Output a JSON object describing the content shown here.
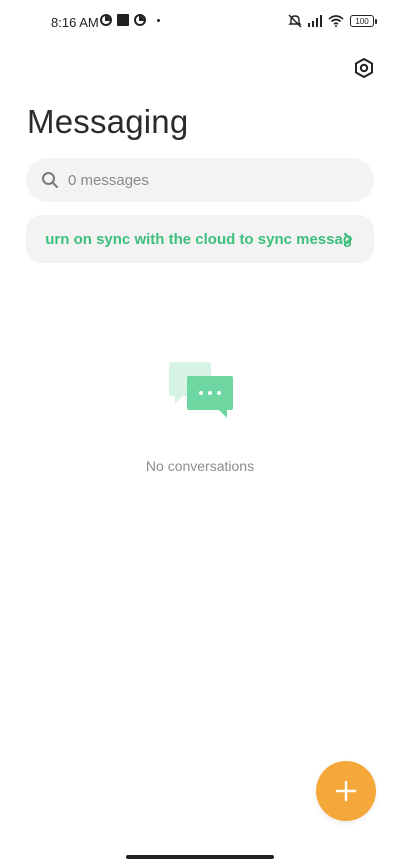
{
  "status_bar": {
    "time": "8:16 AM",
    "battery": "100",
    "icons": [
      "notification-icon",
      "stop-icon",
      "notification-icon",
      "dot-icon",
      "mute-icon",
      "signal-icon",
      "wifi-icon",
      "battery-icon"
    ]
  },
  "header": {
    "title": "Messaging",
    "settings_icon": "settings-icon"
  },
  "search": {
    "placeholder": "0 messages",
    "icon": "search-icon"
  },
  "sync_banner": {
    "text": "Turn on sync with the cloud to sync messages",
    "visible_text": "urn on sync with the cloud to sync messag",
    "icon": "chevron-right-icon",
    "color": "#3dbf7e"
  },
  "empty_state": {
    "text": "No conversations",
    "icon": "chat-bubbles-icon"
  },
  "fab": {
    "icon": "plus-icon",
    "color": "#f5a83a"
  }
}
